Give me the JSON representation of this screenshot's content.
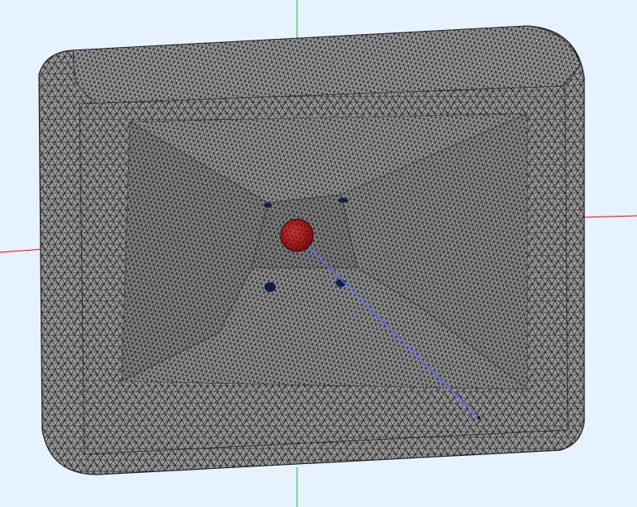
{
  "viewport": {
    "background": "#e6f2ff"
  },
  "axes": {
    "x_axis_color": "#ff0000",
    "y_axis_color": "#00cc00"
  },
  "mesh": {
    "fill_color": "#9a9a9a",
    "wire_color": "#111111"
  },
  "markers": {
    "source_sphere_color": "#c41414",
    "hole_color": "#0b1f4d",
    "ray_color": "#5a6cff"
  }
}
